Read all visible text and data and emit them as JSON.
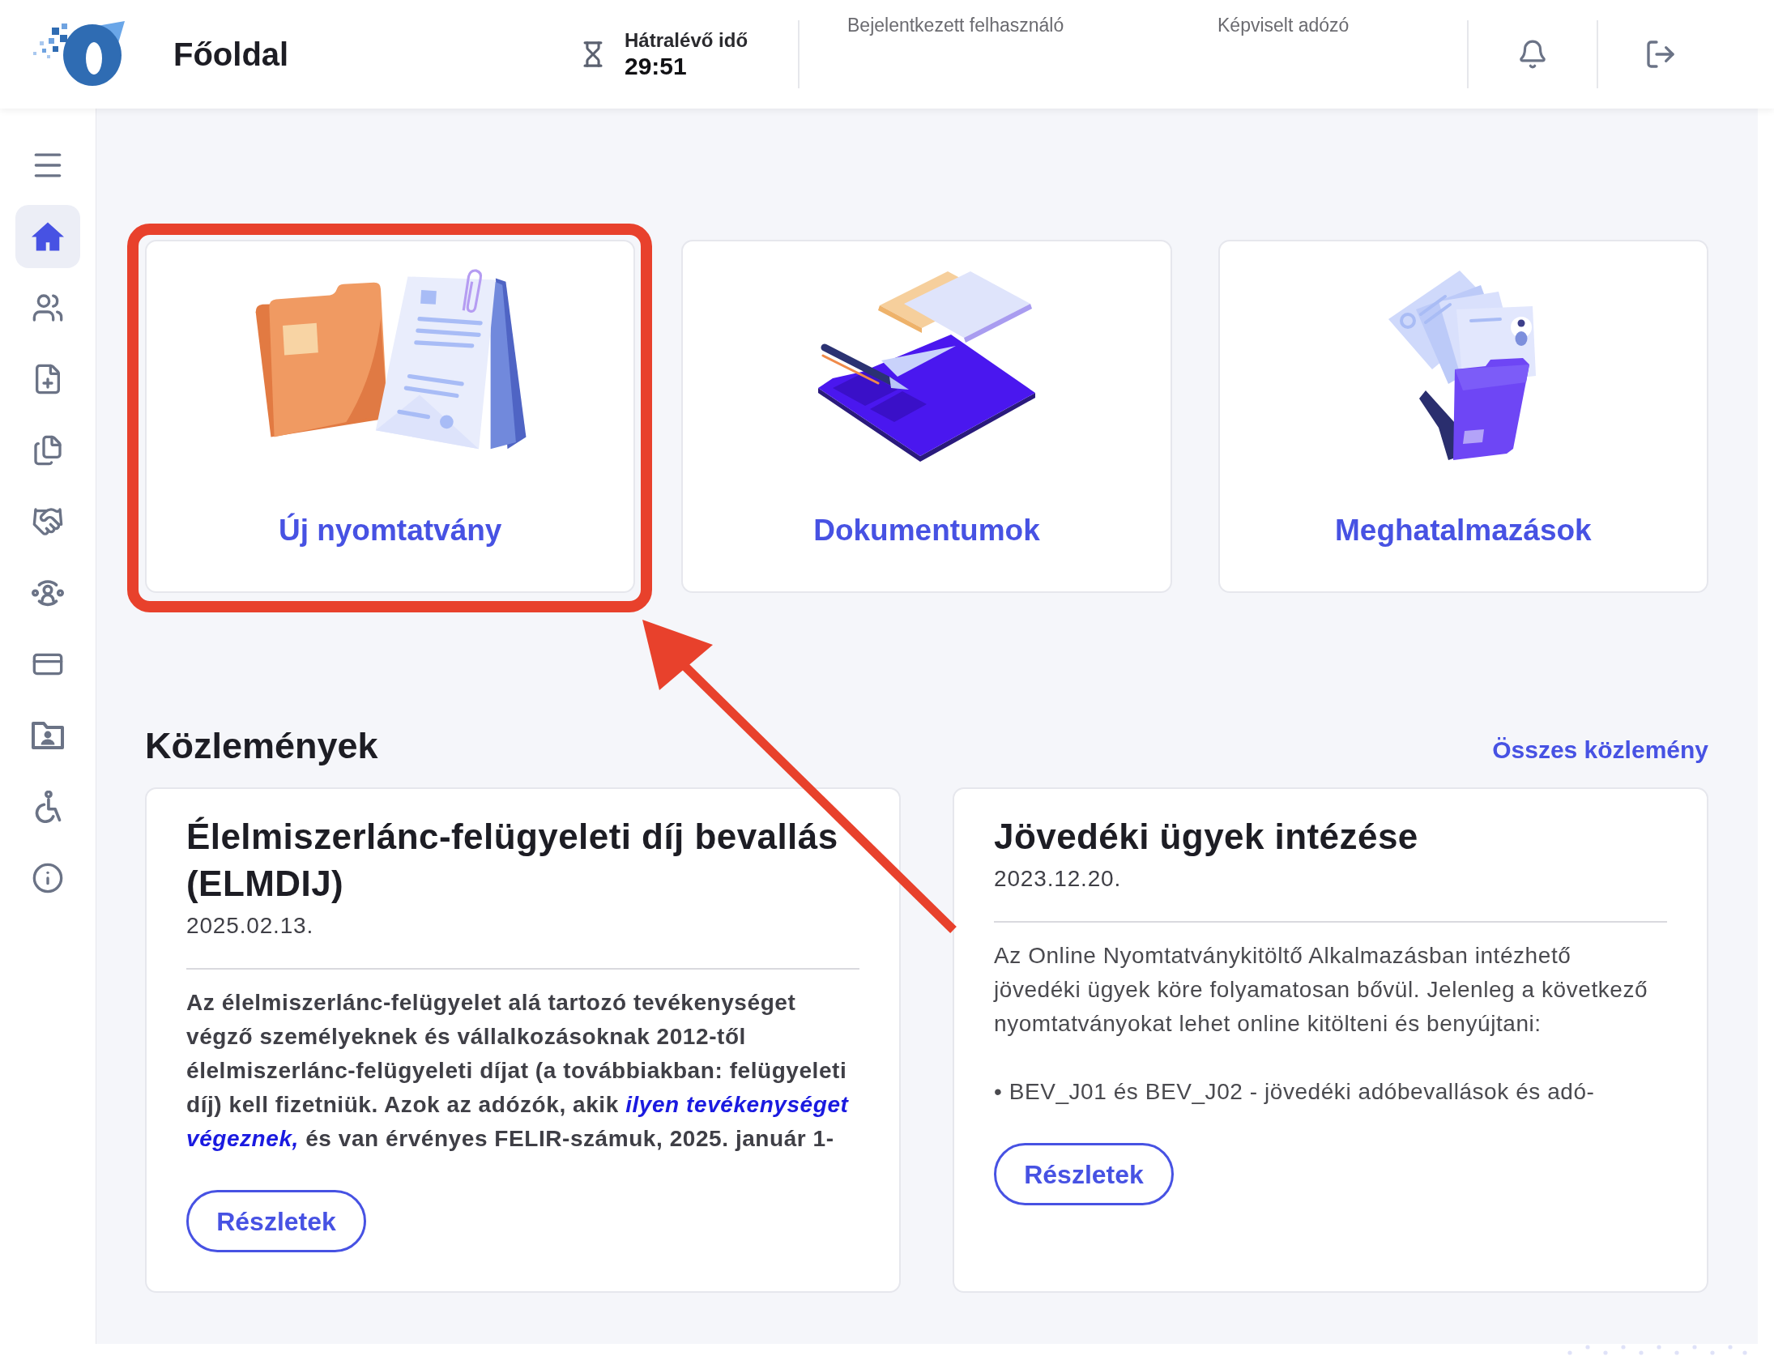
{
  "header": {
    "title": "Főoldal",
    "timer": {
      "label": "Hátralévő idő",
      "value": "29:51"
    },
    "logged_in_label": "Bejelentkezett felhasználó",
    "taxpayer_label": "Képviselt adózó"
  },
  "sidebar": {
    "items": [
      {
        "selected": true
      },
      {
        "selected": false
      },
      {
        "selected": false
      },
      {
        "selected": false
      },
      {
        "selected": false
      },
      {
        "selected": false
      },
      {
        "selected": false
      },
      {
        "selected": false
      },
      {
        "selected": false
      },
      {
        "selected": false
      }
    ]
  },
  "nav_cards": [
    {
      "label": "Új nyomtatvány",
      "highlighted": true
    },
    {
      "label": "Dokumentumok",
      "highlighted": false
    },
    {
      "label": "Meghatalmazások",
      "highlighted": false
    }
  ],
  "annotation_arrow": true,
  "announcements": {
    "title": "Közlemények",
    "all_link": "Összes közlemény",
    "items": [
      {
        "title": "Élelmiszerlánc-felügyeleti díj bevallás (ELMDIJ)",
        "date": "2025.02.13.",
        "bold_body": true,
        "paragraphs": [
          [
            {
              "kind": "text",
              "text": "Az élelmiszerlánc-felügyelet alá tartozó tevékenységet végző személyeknek és vállalkozásoknak 2012-től élelmiszerlánc-felügyeleti díjat (a továbbiakban: felügyeleti díj) kell fizetniük. Azok az adózók, akik "
            },
            {
              "kind": "link",
              "text": "ilyen tevékenységet"
            },
            {
              "kind": "link",
              "text": "végeznek,"
            },
            {
              "kind": "text",
              "text": " és van érvényes FELIR-számuk, 2025. január 1-"
            }
          ]
        ],
        "button": "Részletek"
      },
      {
        "title": "Jövedéki ügyek intézése",
        "date": "2023.12.20.",
        "bold_body": false,
        "paragraphs": [
          [
            {
              "kind": "text",
              "text": "Az Online Nyomtatványkitöltő Alkalmazásban intézhető jövedéki ügyek köre folyamatosan bővül. Jelenleg a következő nyomtatványokat lehet online kitölteni és benyújtani:"
            }
          ],
          [
            {
              "kind": "text",
              "text": "• BEV_J01 és BEV_J02 - jövedéki adóbevallások és adó-"
            }
          ]
        ],
        "button": "Részletek"
      }
    ]
  }
}
